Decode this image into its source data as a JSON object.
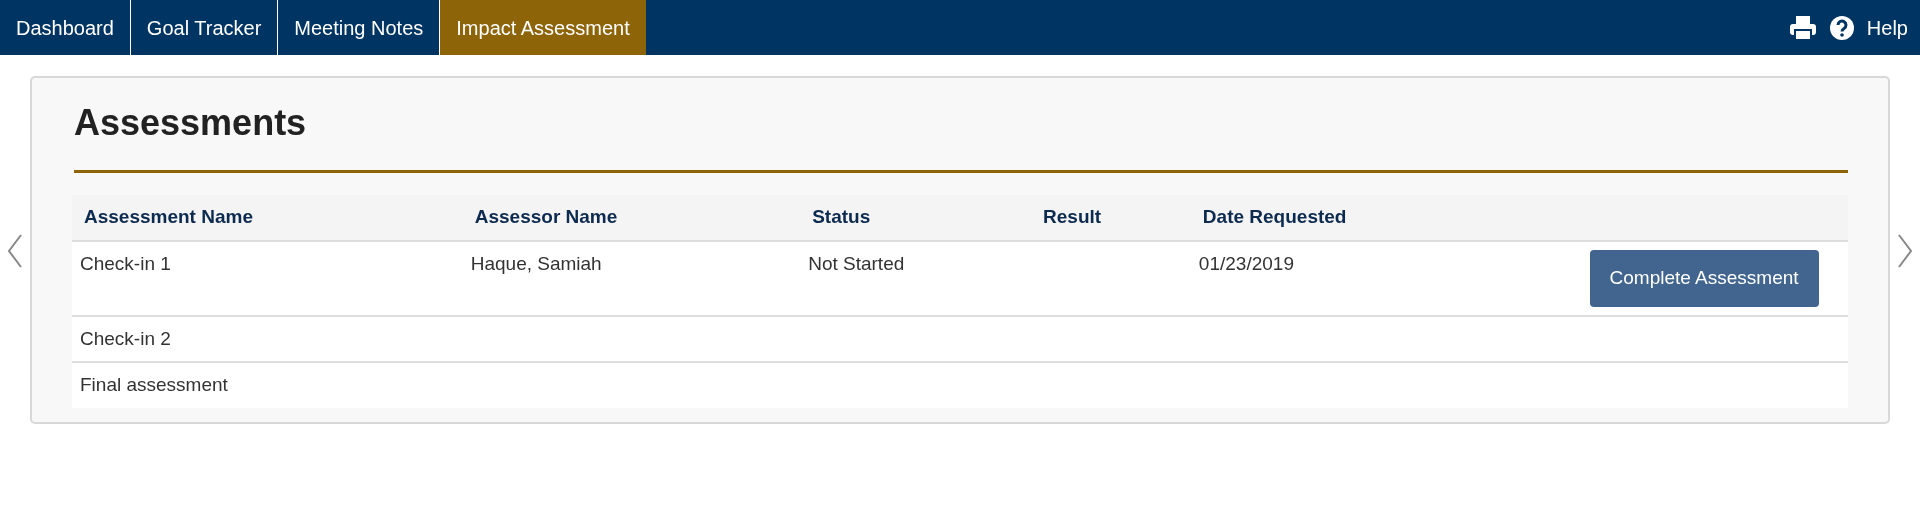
{
  "nav": {
    "tabs": [
      {
        "label": "Dashboard",
        "selected": false
      },
      {
        "label": "Goal Tracker",
        "selected": false
      },
      {
        "label": "Meeting Notes",
        "selected": false
      },
      {
        "label": "Impact Assessment",
        "selected": true
      }
    ],
    "help": "Help"
  },
  "panel": {
    "title": "Assessments",
    "table": {
      "columns": [
        "Assessment Name",
        "Assessor Name",
        "Status",
        "Result",
        "Date Requested"
      ],
      "rows": [
        {
          "cells": [
            "Check-in 1",
            "Haque, Samiah",
            "Not Started",
            "",
            "01/23/2019"
          ],
          "action": "Complete Assessment"
        },
        {
          "cells": [
            "Check-in 2",
            "",
            "",
            "",
            ""
          ]
        },
        {
          "cells": [
            "Final assessment",
            "",
            "",
            "",
            ""
          ]
        }
      ]
    }
  }
}
